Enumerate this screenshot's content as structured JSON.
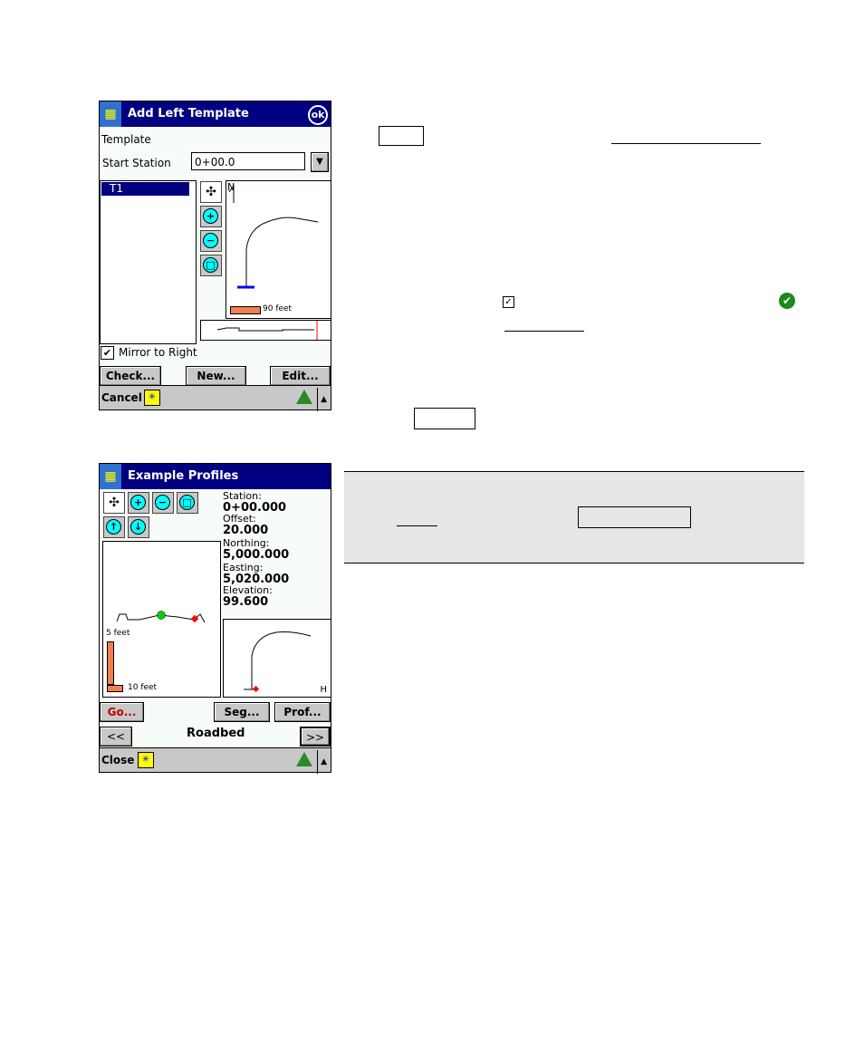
{
  "screen1": {
    "title": "Add Left Template",
    "ok_label": "ok",
    "template_label": "Template",
    "start_station_label": "Start Station",
    "start_station_value": "0+00.0",
    "list_items": [
      "T1"
    ],
    "north_label": "N",
    "scale_label": "90 feet",
    "mirror_label": "Mirror to Right",
    "mirror_checked": true,
    "buttons": {
      "check": "Check...",
      "new": "New...",
      "edit": "Edit..."
    },
    "cancel_label": "Cancel"
  },
  "screen2": {
    "title": "Example Profiles",
    "fields": [
      {
        "label": "Station:",
        "value": "0+00.000"
      },
      {
        "label": "Offset:",
        "value": "20.000"
      },
      {
        "label": "Northing:",
        "value": "5,000.000"
      },
      {
        "label": "Easting:",
        "value": "5,020.000"
      },
      {
        "label": "Elevation:",
        "value": "99.600"
      }
    ],
    "vscale_label": "5 feet",
    "hscale_label": "10 feet",
    "h_label": "H",
    "buttons": {
      "go": "Go...",
      "seg": "Seg...",
      "prof": "Prof...",
      "prev": "<<",
      "next": ">>"
    },
    "segment_name": "Roadbed",
    "close_label": "Close"
  },
  "colors": {
    "title_bar": "#000080",
    "scale_bar": "#f08050",
    "go_text": "#c00000"
  }
}
